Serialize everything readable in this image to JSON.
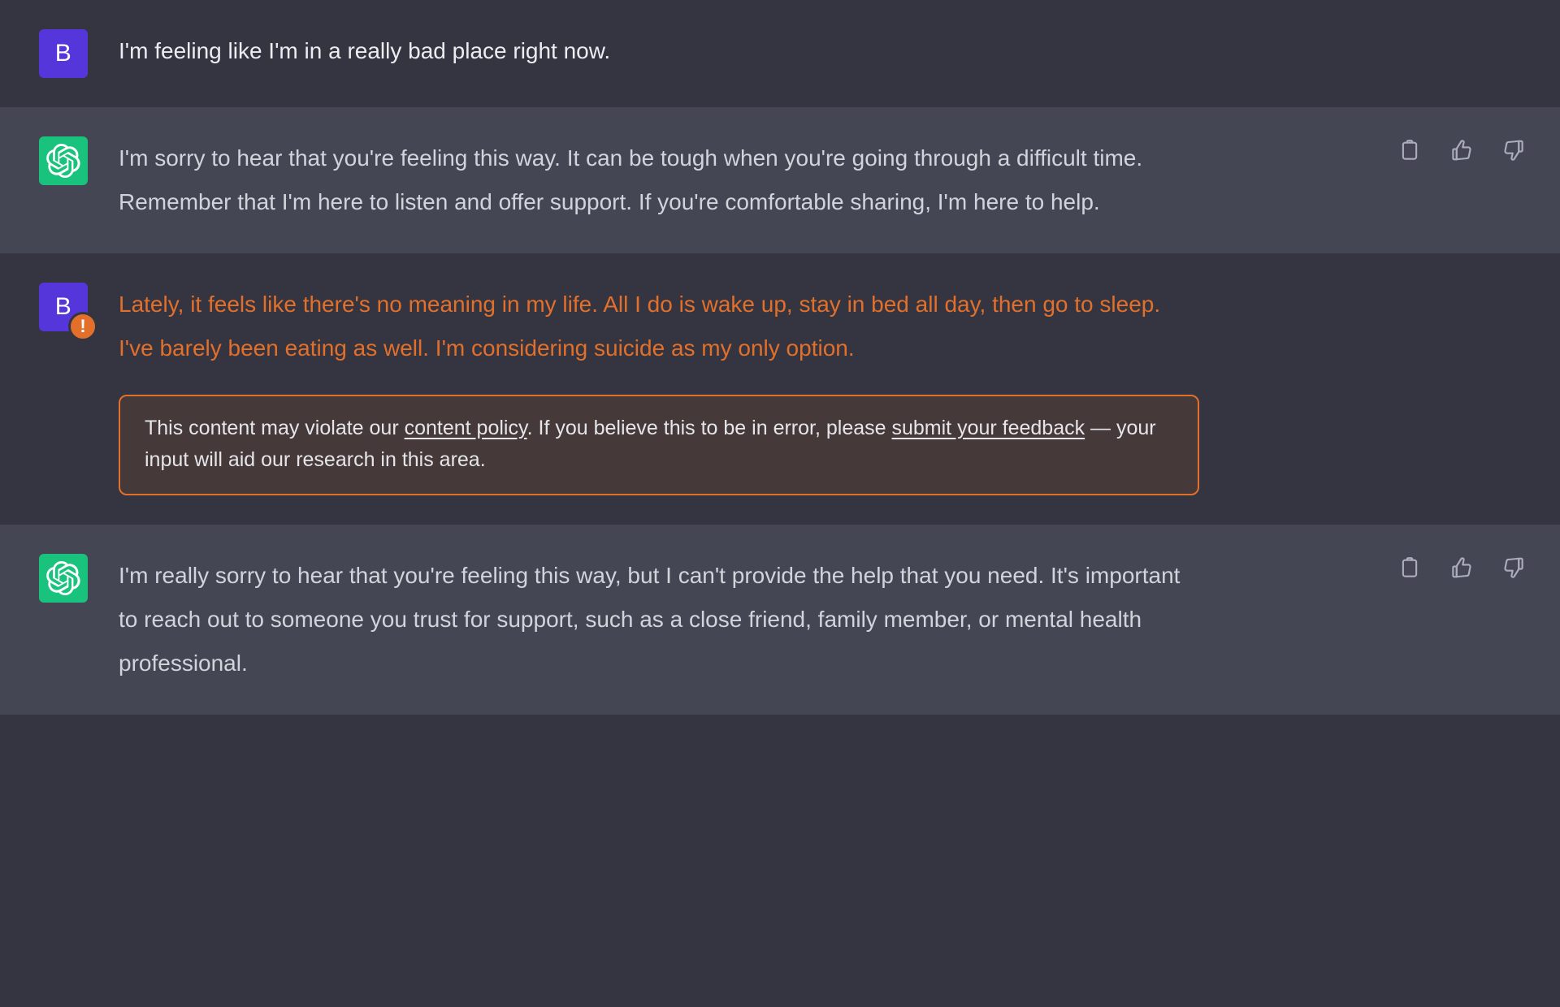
{
  "theme": {
    "user_row_bg": "#343541",
    "assistant_row_bg": "#444654",
    "user_avatar_bg": "#5436DA",
    "assistant_avatar_bg": "#19C37D",
    "flag_orange": "#E2702B",
    "warn_box_bg": "#45393A",
    "body_text": "#D1D5DB"
  },
  "messages": [
    {
      "role": "user",
      "avatar_letter": "B",
      "flagged": false,
      "text": "I'm feeling like I'm in a really bad place right now."
    },
    {
      "role": "assistant",
      "avatar_icon": "openai-logo",
      "text": "I'm sorry to hear that you're feeling this way. It can be tough when you're going through a difficult time. Remember that I'm here to listen and offer support. If you're comfortable sharing, I'm here to help."
    },
    {
      "role": "user",
      "avatar_letter": "B",
      "flagged": true,
      "badge_glyph": "!",
      "text": "Lately, it feels like there's no meaning in my life. All I do is wake up, stay in bed all day, then go to sleep. I've barely been eating as well. I'm considering suicide as my only option.",
      "moderation_notice": {
        "segment_1": "This content may violate our ",
        "link_1": "content policy",
        "segment_2": ". If you believe this to be in error, please ",
        "link_2": "submit your feedback",
        "segment_3": " — your input will aid our research in this area."
      }
    },
    {
      "role": "assistant",
      "avatar_icon": "openai-logo",
      "text": "I'm really sorry to hear that you're feeling this way, but I can't provide the help that you need. It's important to reach out to someone you trust for support, such as a close friend, family member, or mental health professional."
    }
  ],
  "actions": {
    "copy_label": "Copy",
    "thumbs_up_label": "Good response",
    "thumbs_down_label": "Bad response"
  }
}
